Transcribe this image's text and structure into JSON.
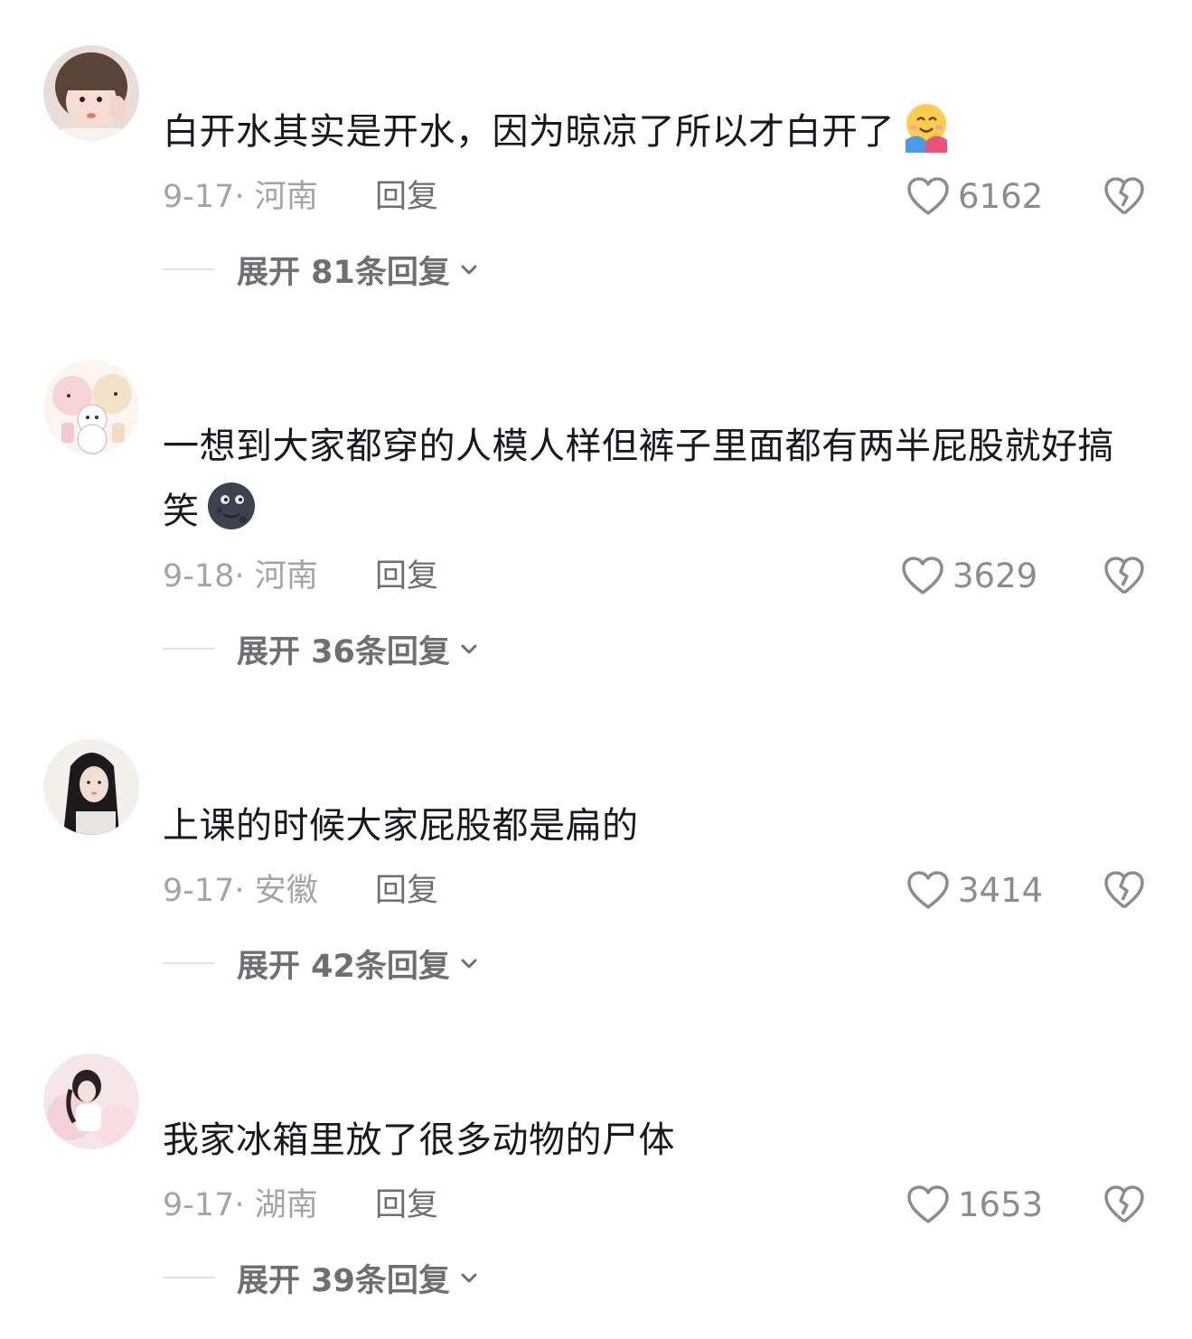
{
  "comments": [
    {
      "text": "白开水其实是开水，因为晾凉了所以才白开了",
      "emoji": "smiling-face-with-hug-emoji",
      "date": "9-17",
      "separator": "·",
      "location": "河南",
      "reply_label": "回复",
      "likes": "6162",
      "expand_label": "展开 81条回复"
    },
    {
      "text": "一想到大家都穿的人模人样但裤子里面都有两半屁股就好搞笑",
      "emoji": "new-moon-face-emoji",
      "date": "9-18",
      "separator": "·",
      "location": "河南",
      "reply_label": "回复",
      "likes": "3629",
      "expand_label": "展开 36条回复"
    },
    {
      "text": "上课的时候大家屁股都是扁的",
      "emoji": "",
      "date": "9-17",
      "separator": "·",
      "location": "安徽",
      "reply_label": "回复",
      "likes": "3414",
      "expand_label": "展开 42条回复"
    },
    {
      "text": "我家冰箱里放了很多动物的尸体",
      "emoji": "",
      "date": "9-17",
      "separator": "·",
      "location": "湖南",
      "reply_label": "回复",
      "likes": "1653",
      "expand_label": "展开 39条回复"
    }
  ],
  "icons": {
    "like": "heart-outline-icon",
    "dislike": "broken-heart-outline-icon",
    "expand": "chevron-down-icon"
  },
  "colors": {
    "text": "#161823",
    "meta": "#a3a4a9",
    "secondary": "#6e6f75",
    "divider": "#e3e3e5"
  }
}
